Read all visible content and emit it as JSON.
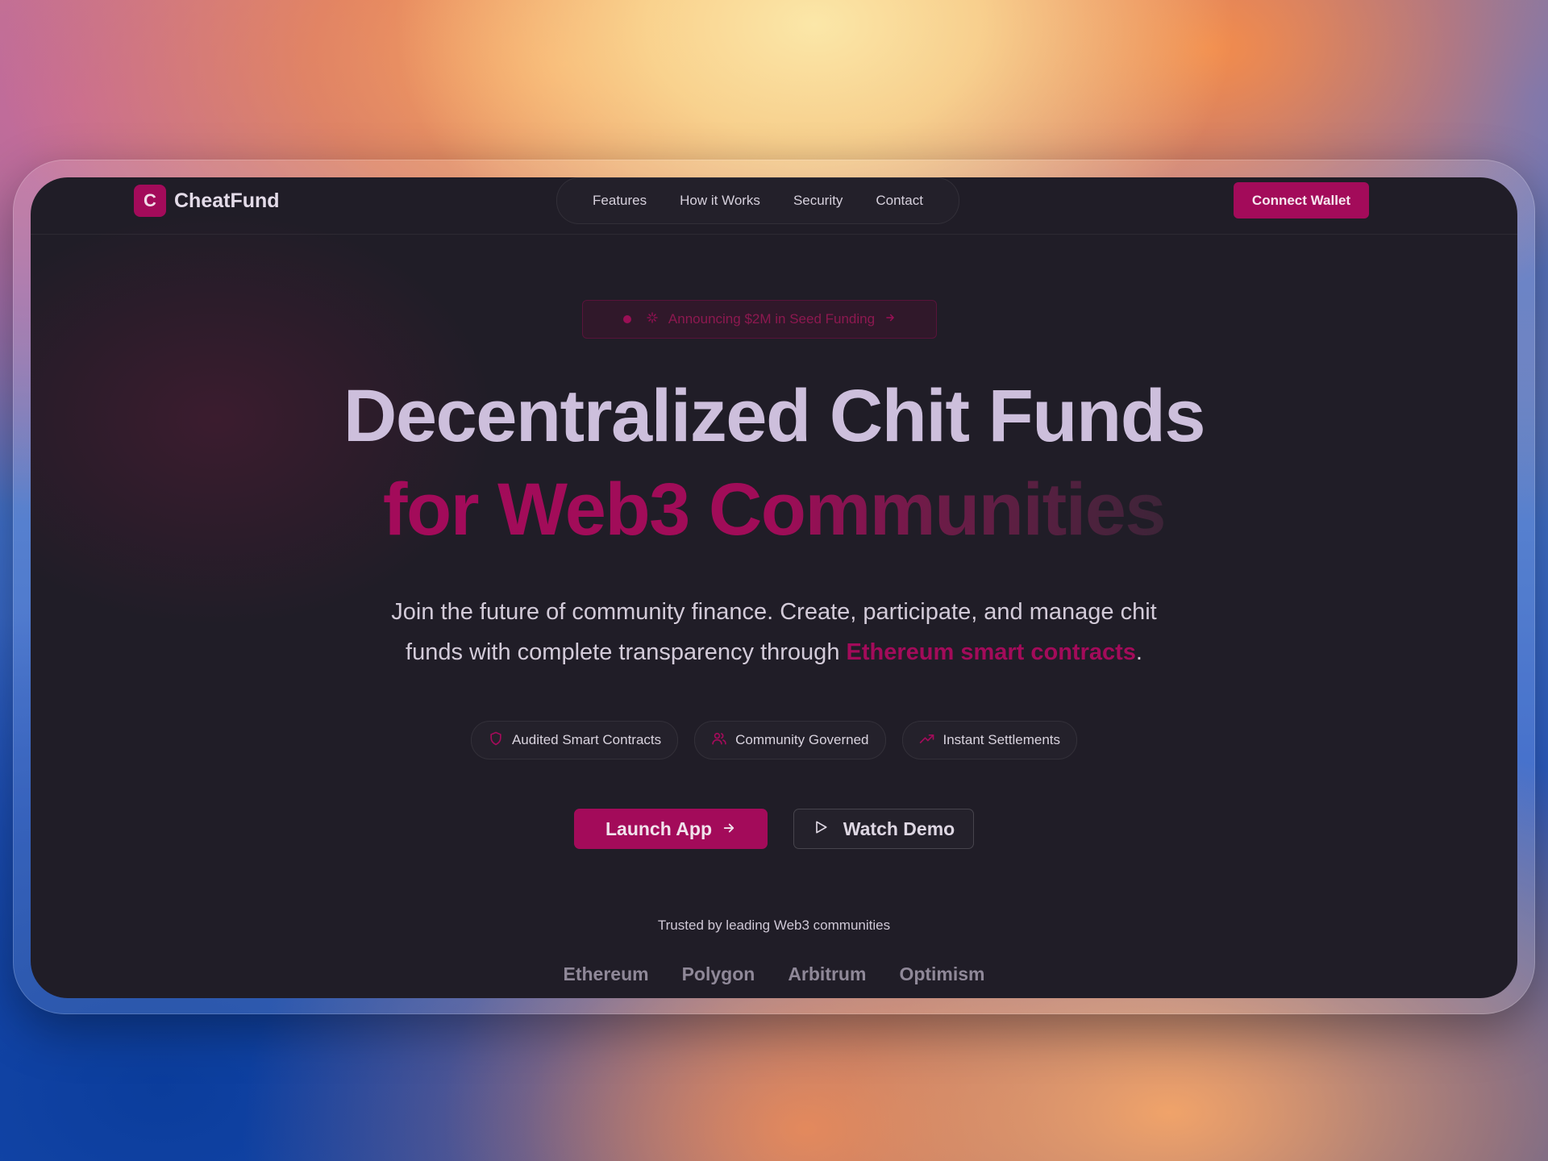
{
  "brand": {
    "logo_letter": "C",
    "name": "CheatFund"
  },
  "nav": {
    "links": [
      {
        "label": "Features"
      },
      {
        "label": "How it Works"
      },
      {
        "label": "Security"
      },
      {
        "label": "Contact"
      }
    ],
    "connect_label": "Connect Wallet"
  },
  "announcement": {
    "text": "Announcing $2M in Seed Funding",
    "icon": "sparkle-icon"
  },
  "hero": {
    "title": "Decentralized Chit Funds",
    "subtitle": "for Web3 Communities",
    "description_start": "Join the future of community finance. Create, participate, and manage chit funds with complete transparency through ",
    "description_link": "Ethereum smart contracts",
    "description_end": "."
  },
  "features": [
    {
      "label": "Audited Smart Contracts",
      "icon": "shield-icon"
    },
    {
      "label": "Community Governed",
      "icon": "users-icon"
    },
    {
      "label": "Instant Settlements",
      "icon": "trending-up-icon"
    }
  ],
  "cta": {
    "primary_label": "Launch App",
    "secondary_label": "Watch Demo"
  },
  "trusted": {
    "text": "Trusted by leading Web3 communities",
    "partners": [
      "Ethereum",
      "Polygon",
      "Arbitrum",
      "Optimism"
    ]
  },
  "colors": {
    "accent": "#a30b5a",
    "background": "#201d27",
    "title": "#cdbfdc"
  }
}
